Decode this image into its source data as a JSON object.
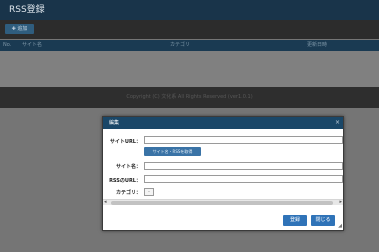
{
  "app": {
    "title": "RSS登録"
  },
  "toolbar": {
    "add_label": "✚ 追加"
  },
  "table": {
    "columns": [
      "No.",
      "サイト名",
      "カテゴリ",
      "更新日時"
    ]
  },
  "footer": {
    "copyright": "Copyright (C) 文化系 All Rights Reserved (ver1.0.1)"
  },
  "modal": {
    "title": "編集",
    "close_glyph": "×",
    "fields": {
      "site_url_label": "サイトURL：",
      "site_url_value": "",
      "fetch_button": "サイト名・RSSを取得",
      "site_name_label": "サイト名：",
      "site_name_value": "",
      "rss_url_label": "RSSのURL：",
      "rss_url_value": "",
      "category_label": "カテゴリ：",
      "category_value": "-"
    },
    "scroll_left": "◂",
    "scroll_right": "▸",
    "register_button": "登録",
    "close_button": "閉じる",
    "resize_glyph": "◢"
  }
}
